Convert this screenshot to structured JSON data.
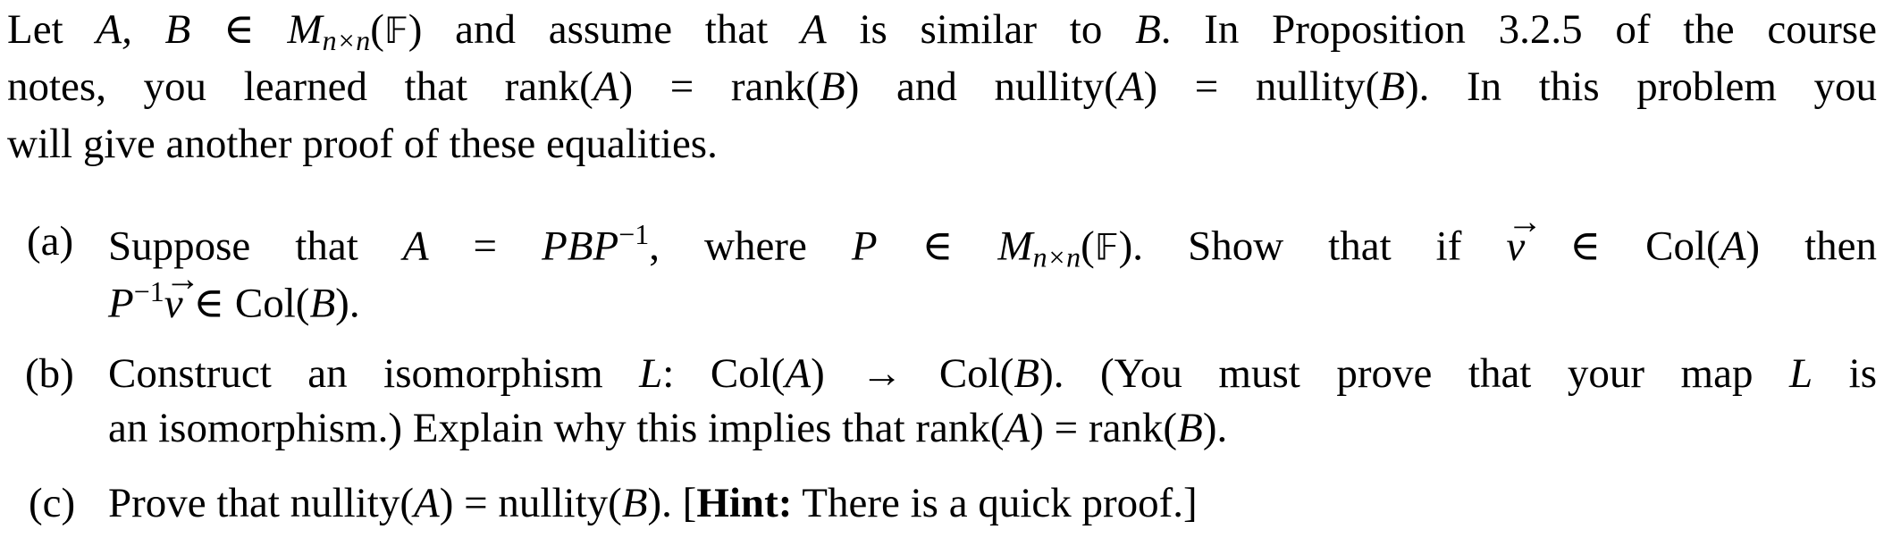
{
  "intro": {
    "line1": {
      "t1": "Let ",
      "m1": "A, B",
      "t2": " ∈ ",
      "m2": "M",
      "sub": "n×n",
      "t3": "(",
      "field": "𝔽",
      "t4": ") and assume that ",
      "m3": "A",
      "t5": " is similar to ",
      "m4": "B",
      "t6": ". In Proposition 3.2.5 of the course"
    },
    "line2": {
      "t1": "notes, you learned that rank(",
      "m1": "A",
      "t2": ") = rank(",
      "m2": "B",
      "t3": ") and nullity(",
      "m3": "A",
      "t4": ") = nullity(",
      "m4": "B",
      "t5": "). In this problem you"
    },
    "line3": "will give another proof of these equalities."
  },
  "items": [
    {
      "label": "(a)",
      "line1": {
        "t1": "Suppose that ",
        "m1": "A",
        "t2": " = ",
        "m2": "PBP",
        "sup": "−1",
        "t3": ", where ",
        "m3": "P",
        "t4": " ∈ ",
        "m4": "M",
        "sub": "n×n",
        "t5": "(",
        "field": "𝔽",
        "t6": ").  Show that if ",
        "vec": "v",
        "t7": " ∈ Col(",
        "m5": "A",
        "t8": ") then"
      },
      "line2": {
        "m1": "P",
        "sup": "−1",
        "vec": "v",
        "t1": " ∈ Col(",
        "m2": "B",
        "t2": ")."
      }
    },
    {
      "label": "(b)",
      "line1": {
        "t1": "Construct an isomorphism ",
        "m1": "L",
        "t2": ": Col(",
        "m2": "A",
        "t3": ") → Col(",
        "m3": "B",
        "t4": "). (You must prove that your map ",
        "m4": "L",
        "t5": " is"
      },
      "line2": {
        "t1": "an isomorphism.) Explain why this implies that rank(",
        "m1": "A",
        "t2": ") = rank(",
        "m2": "B",
        "t3": ")."
      }
    },
    {
      "label": "(c)",
      "line1": {
        "t1": "Prove that nullity(",
        "m1": "A",
        "t2": ") = nullity(",
        "m2": "B",
        "t3": "). [",
        "hint": "Hint:",
        "t4": " There is a quick proof.]"
      }
    }
  ]
}
